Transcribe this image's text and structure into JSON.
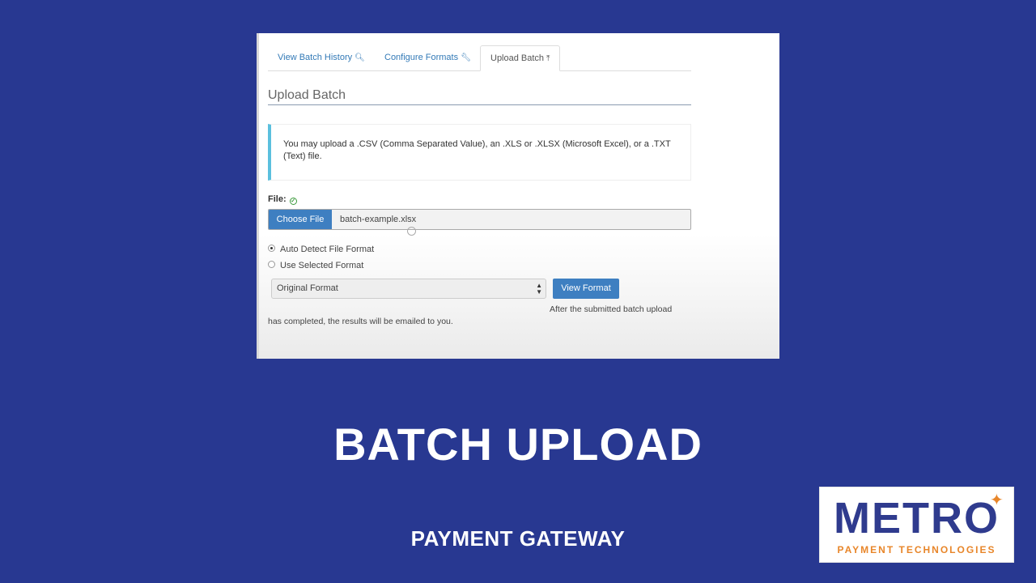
{
  "screenshot": {
    "tabs": [
      {
        "label": "View Batch History",
        "icon": "search-icon",
        "glyph": "🔍︎"
      },
      {
        "label": "Configure Formats",
        "icon": "wrench-icon",
        "glyph": "🔧︎"
      },
      {
        "label": "Upload Batch",
        "icon": "upload-icon",
        "glyph": "⤒"
      }
    ],
    "heading": "Upload Batch",
    "alert_text": "You may upload a .CSV (Comma Separated Value), an .XLS or .XLSX (Microsoft Excel), or a .TXT (Text) file.",
    "file_label": "File:",
    "choose_file_label": "Choose File",
    "file_name": "batch-example.xlsx",
    "radio_auto": "Auto Detect File Format",
    "radio_selected": "Use Selected Format",
    "radio_auto_checked": true,
    "format_select_value": "Original Format",
    "view_format_label": "View Format",
    "note_line1": "After the submitted batch upload",
    "note_line2": "has completed, the results will be emailed to you."
  },
  "title": "BATCH UPLOAD",
  "subtitle": "PAYMENT GATEWAY",
  "logo": {
    "name": "METRO",
    "tagline": "PAYMENT TECHNOLOGIES"
  },
  "colors": {
    "background": "#283891",
    "brand_blue": "#2f3b8e",
    "brand_orange": "#e8862a",
    "button_blue": "#3e7fc1",
    "alert_accent": "#5bc0de"
  }
}
